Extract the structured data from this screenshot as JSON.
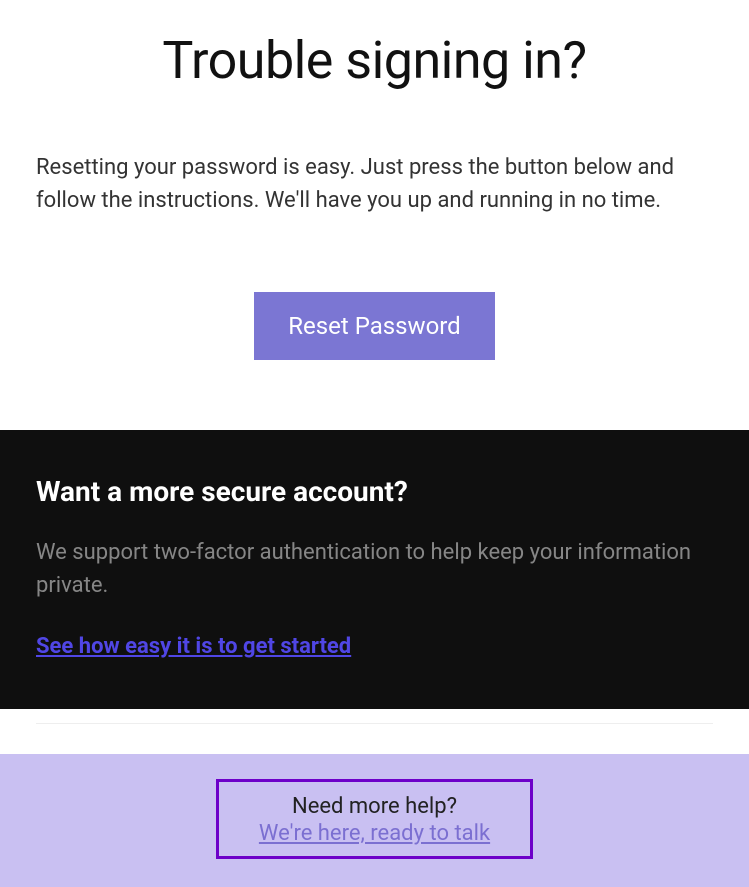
{
  "main": {
    "title": "Trouble signing in?",
    "description": "Resetting your password is easy. Just press the button below and follow the instructions. We'll have you up and running in no time.",
    "reset_button_label": "Reset Password"
  },
  "secure": {
    "title": "Want a more secure account?",
    "description": "We support two-factor authentication to help keep your information private.",
    "link_label": "See how easy it is to get started"
  },
  "help": {
    "title": "Need more help?",
    "link_label": "We're here, ready to talk"
  }
}
